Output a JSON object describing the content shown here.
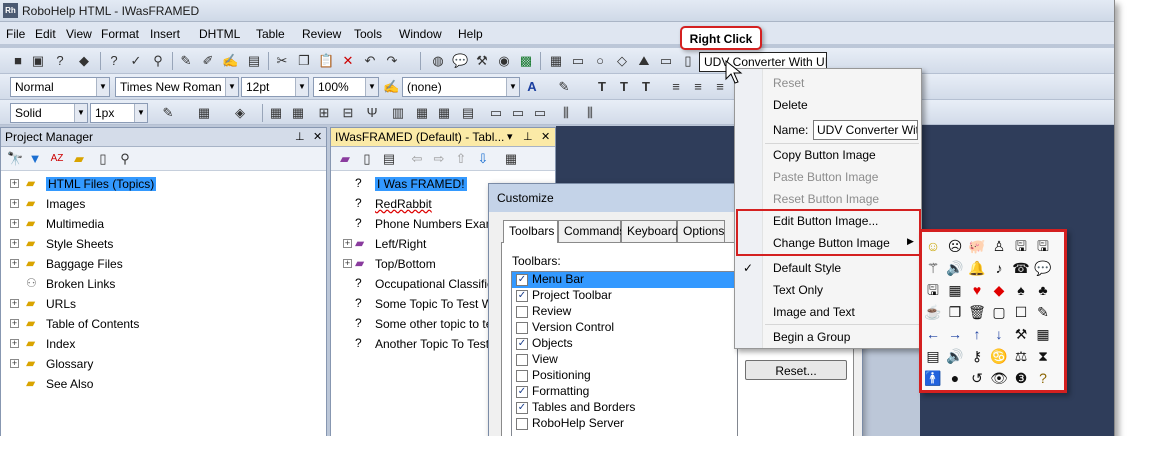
{
  "window": {
    "title": "RoboHelp HTML - IWasFRAMED",
    "app_icon": "Rh"
  },
  "menu": [
    "File",
    "Edit",
    "View",
    "Format",
    "Insert",
    "DHTML",
    "Table",
    "Review",
    "Tools",
    "Window",
    "Help"
  ],
  "toolbar_format": {
    "style": "Normal",
    "font": "Times New Roman",
    "size": "12pt",
    "zoom": "100%",
    "css": "(none)"
  },
  "toolbar_table": {
    "border_style": "Solid",
    "border_width": "1px"
  },
  "udv_button": "UDV Converter With UI",
  "callout": "Right Click",
  "project_manager": {
    "title": "Project Manager",
    "items": [
      "HTML Files (Topics)",
      "Images",
      "Multimedia",
      "Style Sheets",
      "Baggage Files",
      "Broken Links",
      "URLs",
      "Table of Contents",
      "Index",
      "Glossary",
      "See Also"
    ]
  },
  "toc_pane": {
    "title": "IWasFRAMED (Default) - Tabl...",
    "items": [
      "I Was FRAMED!",
      "RedRabbit",
      "Phone Numbers Exampl",
      "Left/Right",
      "Top/Bottom",
      "Occupational Classificat",
      "Some Topic To Test Wi",
      "Some other topic to test",
      "Another Topic To Test V"
    ]
  },
  "customize": {
    "title": "Customize",
    "tabs": [
      "Toolbars",
      "Commands",
      "Keyboard",
      "Options"
    ],
    "toolbars_label": "Toolbars:",
    "toolbars": [
      {
        "label": "Menu Bar",
        "checked": true
      },
      {
        "label": "Project Toolbar",
        "checked": true
      },
      {
        "label": "Review",
        "checked": false
      },
      {
        "label": "Version Control",
        "checked": false
      },
      {
        "label": "Objects",
        "checked": true
      },
      {
        "label": "View",
        "checked": false
      },
      {
        "label": "Positioning",
        "checked": false
      },
      {
        "label": "Formatting",
        "checked": true
      },
      {
        "label": "Tables and Borders",
        "checked": true
      },
      {
        "label": "RoboHelp Server",
        "checked": false
      }
    ],
    "reset_button": "Reset..."
  },
  "context_menu": {
    "reset": "Reset",
    "delete": "Delete",
    "name_label": "Name:",
    "name_value": "UDV Converter With UI",
    "copy_image": "Copy Button Image",
    "paste_image": "Paste Button Image",
    "reset_image": "Reset Button Image",
    "edit_image": "Edit Button Image...",
    "change_image": "Change Button Image",
    "default_style": "Default Style",
    "text_only": "Text Only",
    "image_and_text": "Image and Text",
    "begin_group": "Begin a Group"
  },
  "button_images": [
    "☺",
    "☹",
    "🐖",
    "♙",
    "🖫",
    "🖫",
    "⚚",
    "🔊",
    "🔔",
    "♪",
    "☎",
    "💬",
    "🖫",
    "▦",
    "♥",
    "◆",
    "♠",
    "♣",
    "☕",
    "❒",
    "🗑",
    "▢",
    "☐",
    "✎",
    "←",
    "→",
    "↑",
    "↓",
    "⚒",
    "▦",
    "▤",
    "🔊",
    "⚷",
    "♋",
    "⚖",
    "⧗",
    "🚹",
    "●",
    "↺",
    "👁",
    "❸",
    "?"
  ],
  "colors": {
    "accent_red": "#d42020",
    "selection": "#3399ff",
    "bg_dark": "#2f3d5a"
  }
}
